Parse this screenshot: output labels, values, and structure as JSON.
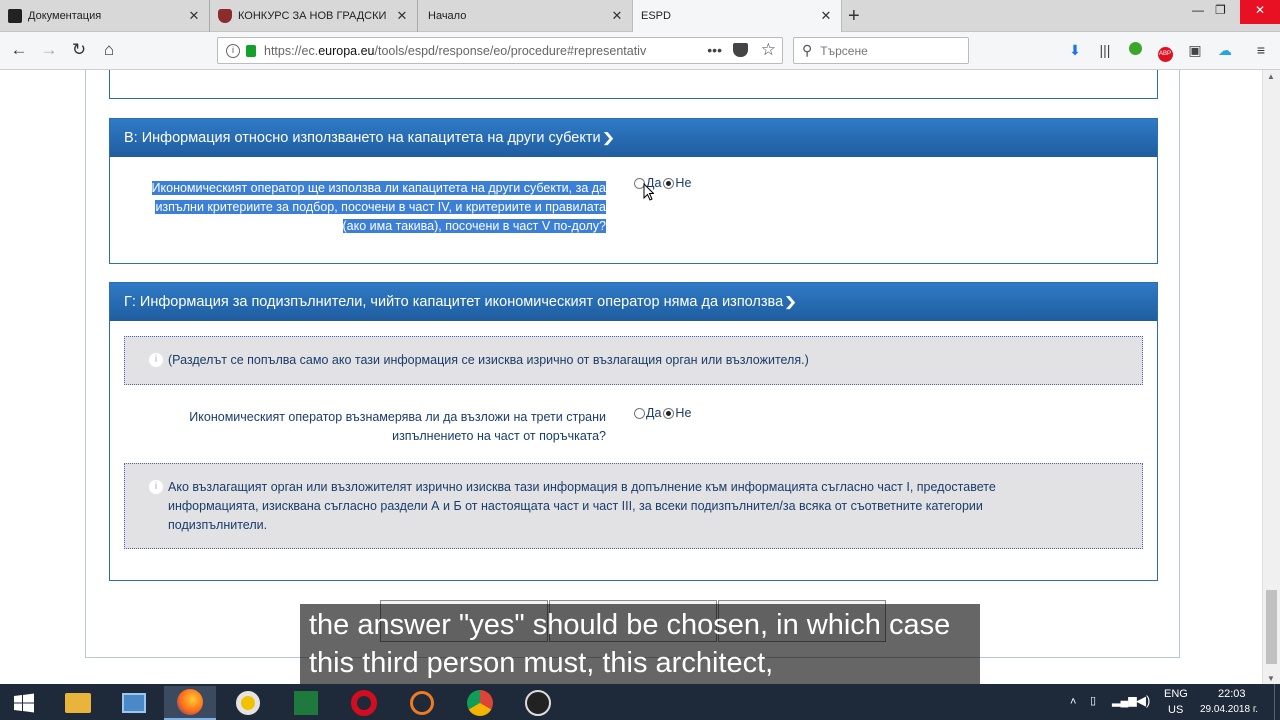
{
  "browser": {
    "tabs": [
      {
        "title": "Документация"
      },
      {
        "title": "КОНКУРС ЗА НОВ ГРАДСКИ ..."
      },
      {
        "title": "Начало"
      },
      {
        "title": "ESPD"
      }
    ],
    "url_prefix": "https://ec.",
    "url_domain": "europa.eu",
    "url_rest": "/tools/espd/response/eo/procedure#representativ",
    "search_placeholder": "Търсене"
  },
  "sectionB": {
    "title": "В: Информация относно използването на капацитета на други субекти",
    "question": "Икономическият оператор ще използва ли капацитета на други субекти, за да изпълни критериите за подбор, посочени в част IV, и критериите и правилата (ако има такива), посочени в част V по-долу?",
    "yes": "Да",
    "no": "Не"
  },
  "sectionG": {
    "title": "Г: Информация за подизпълнители, чийто капацитет икономическият оператор няма да използва",
    "note": "(Разделът се попълва само ако тази информация се изисква изрично от възлагащия орган или възложителя.)",
    "question": "Икономическият оператор възнамерява ли да възложи на трети страни изпълнението на част от поръчката?",
    "yes": "Да",
    "no": "Не",
    "info": "Ако възлагащият орган или възложителят изрично изисква тази информация в допълнение към информацията съгласно част I, предоставете информацията, изисквана съгласно раздели А и Б от настоящата част и част III, за всеки подизпълнител/за всяка от съответните категории подизпълнители."
  },
  "subtitle": "the answer \"yes\" should be chosen, in which case this third person must, this architect,",
  "taskbar": {
    "lang1": "ENG",
    "lang2": "US",
    "time": "22:03",
    "date": "29.04.2018 г."
  },
  "colors": {
    "panel_header": "#2a6fb0",
    "highlight": "#3b7fd6",
    "infobox": "#e2e2e4"
  }
}
